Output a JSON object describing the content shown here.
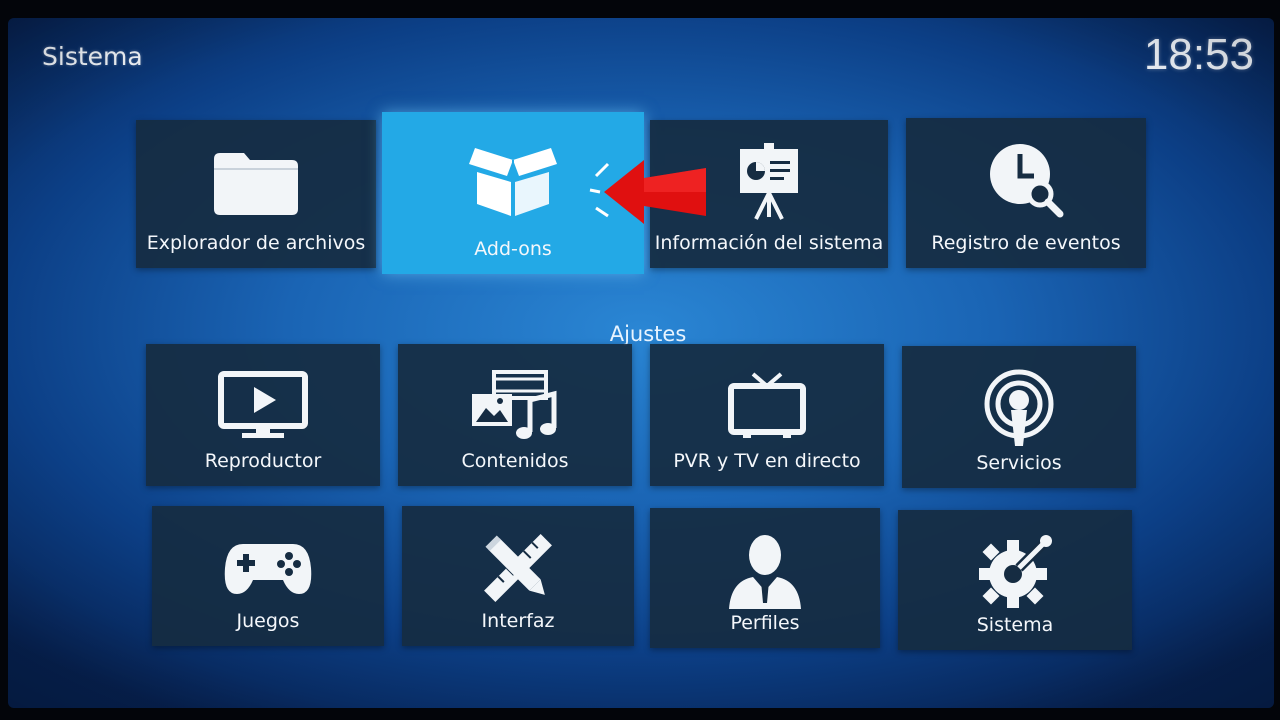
{
  "header": {
    "title": "Sistema",
    "clock": "18:53"
  },
  "top_row": [
    {
      "label": "Explorador de archivos",
      "icon": "folder-icon"
    },
    {
      "label": "Add-ons",
      "icon": "open-box-icon",
      "focused": true
    },
    {
      "label": "Información del sistema",
      "icon": "presentation-board-icon"
    },
    {
      "label": "Registro de eventos",
      "icon": "clock-search-icon"
    }
  ],
  "section_label": "Ajustes",
  "settings": [
    {
      "label": "Reproductor",
      "icon": "monitor-play-icon"
    },
    {
      "label": "Contenidos",
      "icon": "media-library-icon"
    },
    {
      "label": "PVR y TV en directo",
      "icon": "tv-antenna-icon"
    },
    {
      "label": "Servicios",
      "icon": "broadcast-icon"
    },
    {
      "label": "Juegos",
      "icon": "gamepad-icon"
    },
    {
      "label": "Interfaz",
      "icon": "pencil-ruler-icon"
    },
    {
      "label": "Perfiles",
      "icon": "user-profile-icon"
    },
    {
      "label": "Sistema",
      "icon": "gear-wrench-icon"
    }
  ],
  "colors": {
    "tile": "#162c42",
    "focused_tile": "#23a9e6",
    "arrow": "#e01010"
  }
}
